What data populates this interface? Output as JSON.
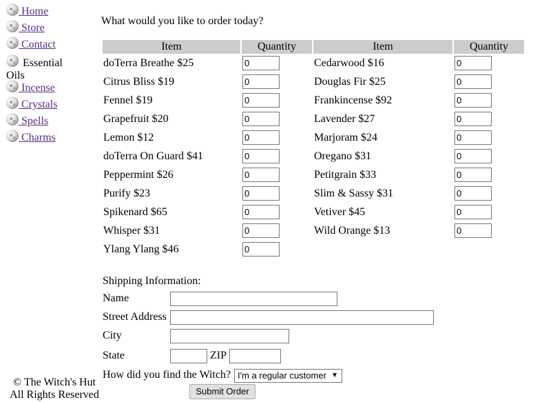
{
  "sidebar": {
    "items": [
      {
        "label": " Home",
        "icon": "moon-icon"
      },
      {
        "label": " Store",
        "icon": "moon-icon"
      },
      {
        "label": " Contact",
        "icon": "moon-icon"
      },
      {
        "label": " Essential Oils",
        "icon": "moon-icon",
        "current": true
      },
      {
        "label": " Incense",
        "icon": "moon-icon"
      },
      {
        "label": " Crystals",
        "icon": "moon-icon"
      },
      {
        "label": " Spells",
        "icon": "moon-icon"
      },
      {
        "label": " Charms",
        "icon": "moon-icon"
      }
    ],
    "link_color": "#5b2a86"
  },
  "prompt": "What would you like to order today?",
  "table": {
    "headers": [
      "Item",
      "Quantity",
      "Item",
      "Quantity"
    ],
    "header_bg": "#cccccc",
    "left": [
      {
        "item": "doTerra Breathe $25",
        "qty": "0"
      },
      {
        "item": "Citrus Bliss $19",
        "qty": "0"
      },
      {
        "item": "Fennel $19",
        "qty": "0"
      },
      {
        "item": "Grapefruit $20",
        "qty": "0"
      },
      {
        "item": "Lemon $12",
        "qty": "0"
      },
      {
        "item": "doTerra On Guard $41",
        "qty": "0"
      },
      {
        "item": "Peppermint $26",
        "qty": "0"
      },
      {
        "item": "Purify $23",
        "qty": "0"
      },
      {
        "item": "Spikenard $65",
        "qty": "0"
      },
      {
        "item": "Whisper $31",
        "qty": "0"
      },
      {
        "item": "Ylang Ylang $46",
        "qty": "0"
      }
    ],
    "right": [
      {
        "item": "Cedarwood $16",
        "qty": "0"
      },
      {
        "item": "Douglas Fir $25",
        "qty": "0"
      },
      {
        "item": "Frankincense $92",
        "qty": "0"
      },
      {
        "item": "Lavender $27",
        "qty": "0"
      },
      {
        "item": "Marjoram $24",
        "qty": "0"
      },
      {
        "item": "Oregano $31",
        "qty": "0"
      },
      {
        "item": "Petitgrain $33",
        "qty": "0"
      },
      {
        "item": "Slim & Sassy $31",
        "qty": "0"
      },
      {
        "item": "Vetiver $45",
        "qty": "0"
      },
      {
        "item": "Wild Orange $13",
        "qty": "0"
      }
    ]
  },
  "shipping": {
    "heading": "Shipping Information:",
    "name_label": "Name",
    "name_value": "",
    "street_label": "Street Address",
    "street_value": "",
    "city_label": "City",
    "city_value": "",
    "state_label": "State",
    "state_value": "",
    "zip_label": "ZIP",
    "zip_value": "",
    "found_label": "How did you find the Witch?",
    "found_selected": "I'm a regular customer",
    "submit_label": "Submit Order"
  },
  "footer": {
    "line1": "© The Witch's Hut",
    "line2": "All Rights Reserved"
  }
}
